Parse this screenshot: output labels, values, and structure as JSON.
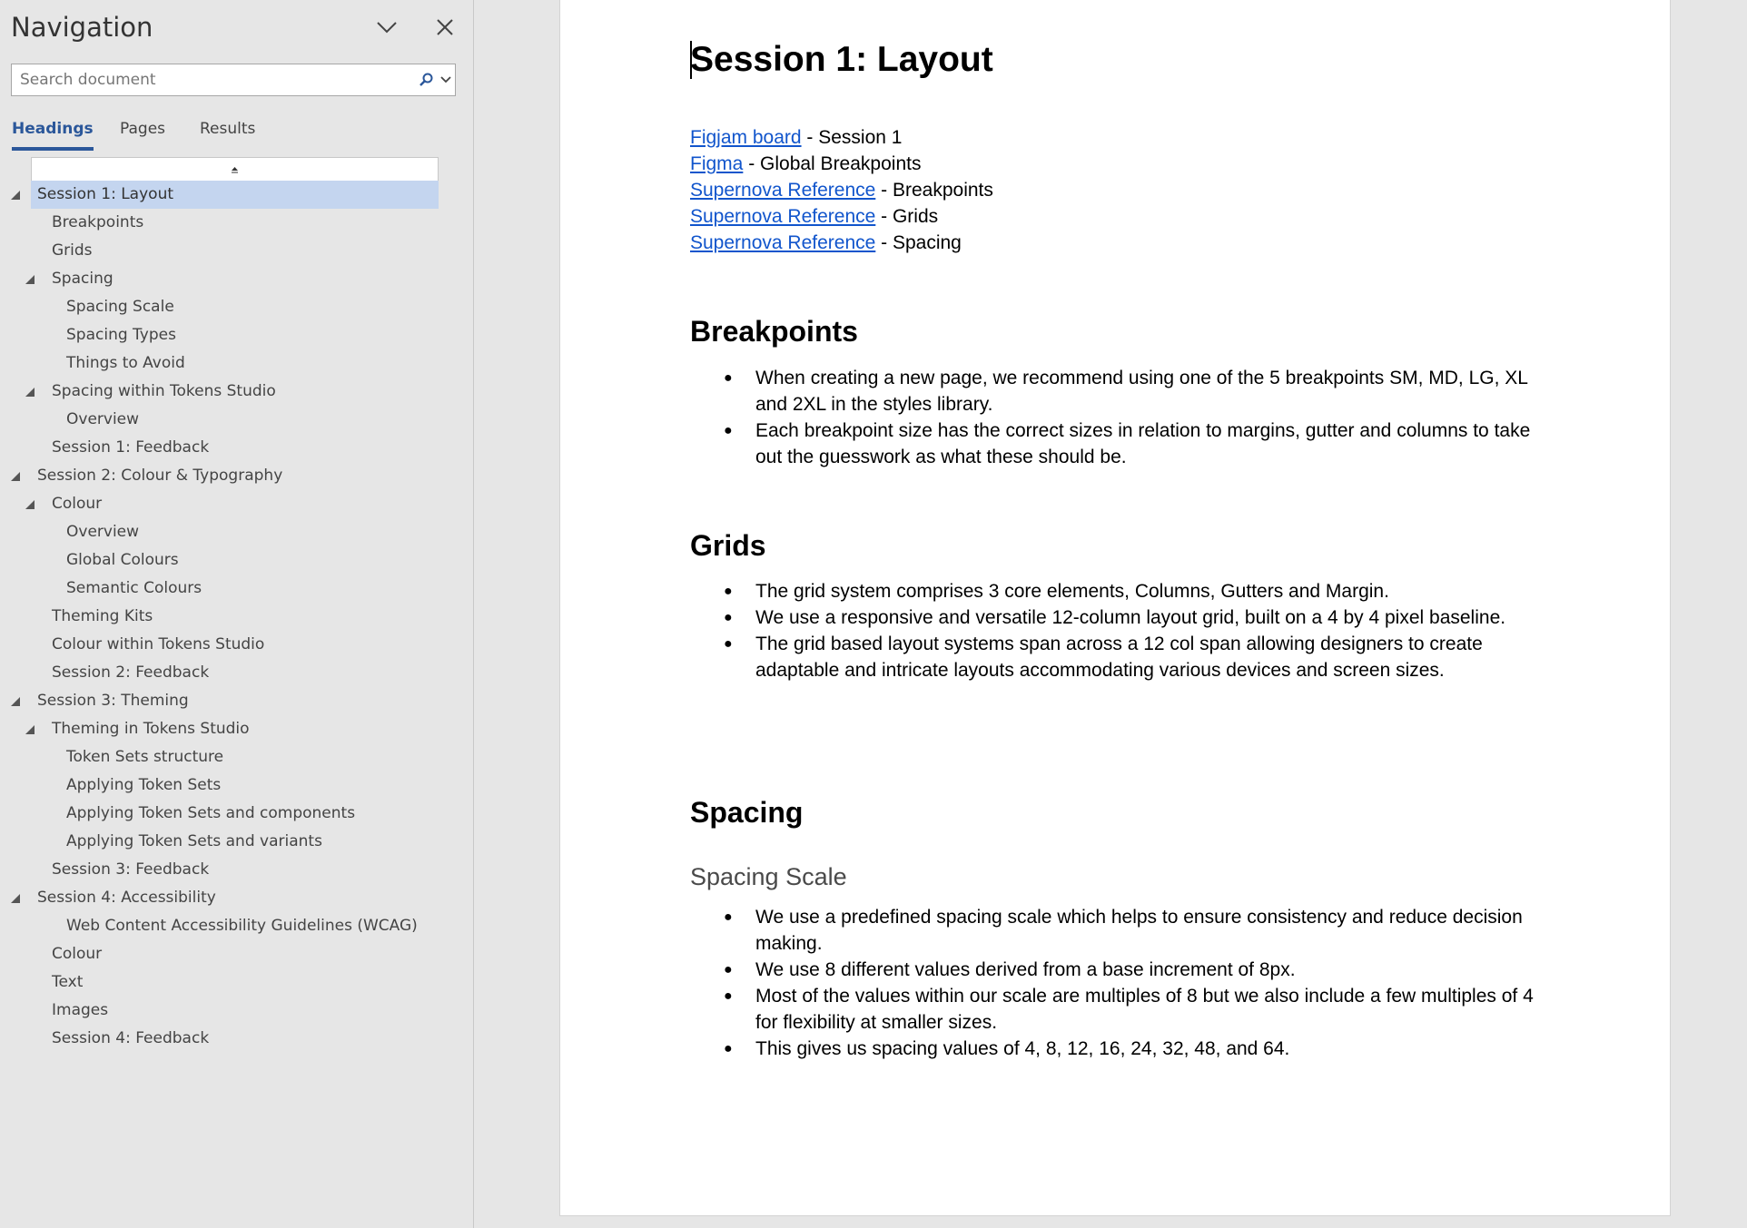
{
  "nav": {
    "title": "Navigation",
    "search_placeholder": "Search document",
    "tabs": [
      "Headings",
      "Pages",
      "Results"
    ],
    "headings": [
      {
        "label": "Session 1: Layout",
        "level": 1,
        "expanded": true,
        "selected": true
      },
      {
        "label": "Breakpoints",
        "level": 2
      },
      {
        "label": "Grids",
        "level": 2
      },
      {
        "label": "Spacing",
        "level": 2,
        "expanded": true
      },
      {
        "label": "Spacing Scale",
        "level": 3
      },
      {
        "label": "Spacing Types",
        "level": 3
      },
      {
        "label": "Things to Avoid",
        "level": 3
      },
      {
        "label": "Spacing within Tokens Studio",
        "level": 2,
        "expanded": true
      },
      {
        "label": "Overview",
        "level": 3
      },
      {
        "label": "Session 1: Feedback",
        "level": 2
      },
      {
        "label": "Session 2: Colour & Typography",
        "level": 1,
        "expanded": true
      },
      {
        "label": "Colour",
        "level": 2,
        "expanded": true
      },
      {
        "label": "Overview",
        "level": 3
      },
      {
        "label": "Global Colours",
        "level": 3
      },
      {
        "label": "Semantic Colours",
        "level": 3
      },
      {
        "label": "Theming Kits",
        "level": 2
      },
      {
        "label": "Colour within Tokens Studio",
        "level": 2
      },
      {
        "label": "Session 2: Feedback",
        "level": 2
      },
      {
        "label": "Session 3: Theming",
        "level": 1,
        "expanded": true
      },
      {
        "label": "Theming in Tokens Studio",
        "level": 2,
        "expanded": true
      },
      {
        "label": "Token Sets structure",
        "level": 3
      },
      {
        "label": "Applying Token Sets",
        "level": 3
      },
      {
        "label": "Applying Token Sets and components",
        "level": 3
      },
      {
        "label": "Applying Token Sets and variants",
        "level": 3
      },
      {
        "label": "Session 3: Feedback",
        "level": 2
      },
      {
        "label": "Session 4: Accessibility",
        "level": 1,
        "expanded": true
      },
      {
        "label": "Web Content Accessibility Guidelines (WCAG)",
        "level": 3
      },
      {
        "label": "Colour",
        "level": 2
      },
      {
        "label": "Text",
        "level": 2
      },
      {
        "label": "Images",
        "level": 2
      },
      {
        "label": "Session 4: Feedback",
        "level": 2
      }
    ]
  },
  "doc": {
    "title": "Session 1: Layout",
    "links": [
      {
        "link": "Figjam board",
        "text": " - Session 1"
      },
      {
        "link": "Figma",
        "text": " - Global Breakpoints"
      },
      {
        "link": "Supernova Reference",
        "text": " - Breakpoints"
      },
      {
        "link": "Supernova Reference",
        "text": " - Grids"
      },
      {
        "link": "Supernova Reference",
        "text": " - Spacing"
      }
    ],
    "breakpoints": {
      "heading": "Breakpoints",
      "bullets": [
        "When creating a new page, we recommend using one of the 5 breakpoints SM, MD, LG, XL and 2XL in the styles library.",
        "Each breakpoint size has the correct sizes in relation to margins, gutter and columns to take out the guesswork as what these should be."
      ]
    },
    "grids": {
      "heading": "Grids",
      "bullets": [
        "The grid system comprises 3 core elements, Columns, Gutters and Margin.",
        "We use a responsive and versatile 12-column layout grid, built on a 4 by 4 pixel baseline.",
        "The grid based layout systems span across a 12 col span allowing designers to create adaptable and intricate layouts accommodating various devices and screen sizes."
      ]
    },
    "spacing": {
      "heading": "Spacing",
      "subheading": "Spacing Scale",
      "bullets": [
        "We use a predefined spacing scale which helps to ensure consistency and reduce decision making.",
        "We use 8 different values derived from a base increment of 8px.",
        "Most of the values within our scale are multiples of 8 but we also include a few multiples of 4 for flexibility at smaller sizes.",
        "This gives us spacing values of 4, 8, 12, 16, 24, 32, 48, and 64."
      ]
    }
  }
}
